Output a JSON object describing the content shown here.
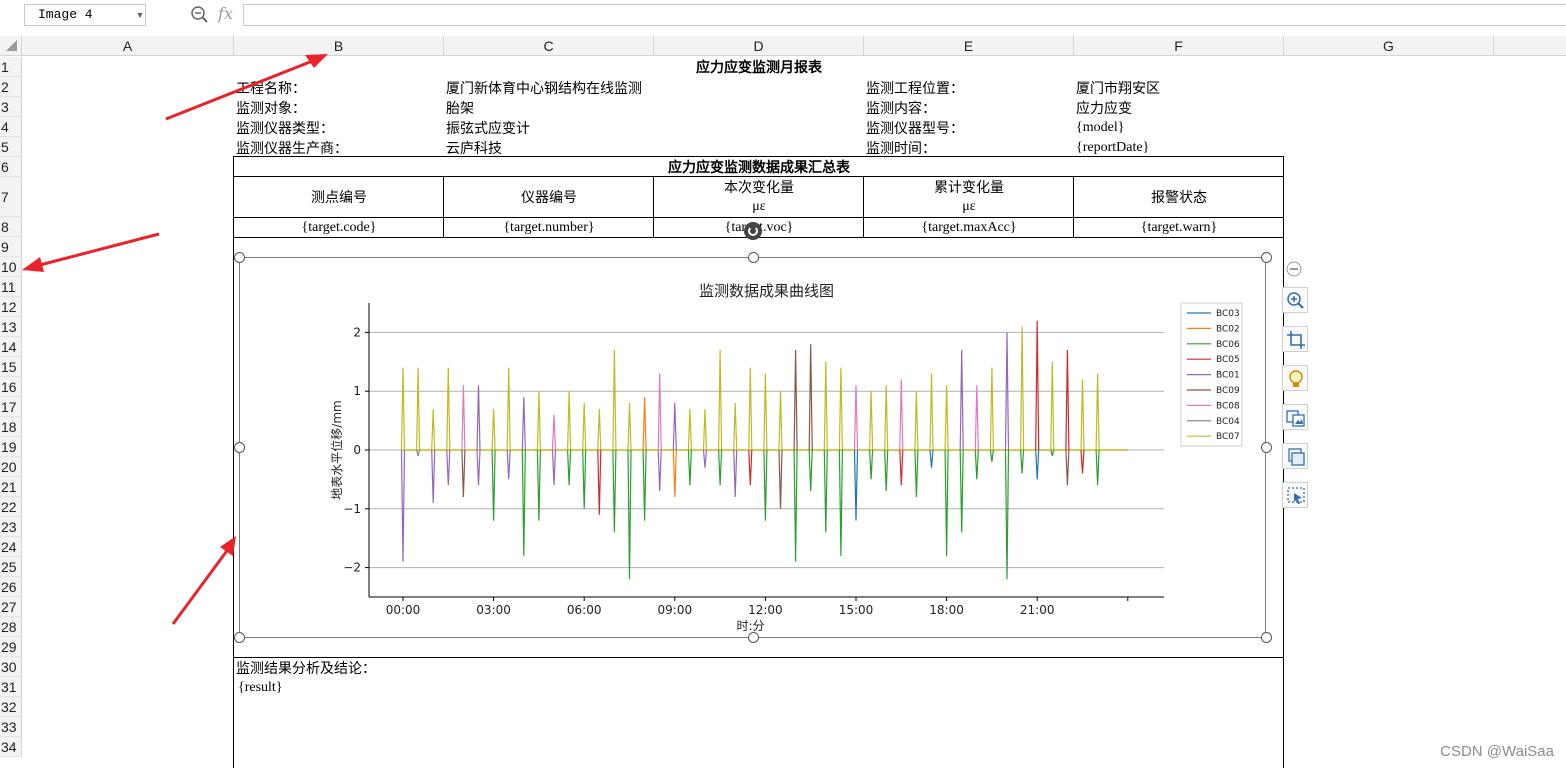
{
  "namebox": "Image 4",
  "formula_fx": "fx",
  "columns": [
    "A",
    "B",
    "C",
    "D",
    "E",
    "F",
    "G"
  ],
  "rows": [
    "1",
    "2",
    "3",
    "4",
    "5",
    "6",
    "7",
    "8",
    "9",
    "10",
    "11",
    "12",
    "13",
    "14",
    "15",
    "16",
    "17",
    "18",
    "19",
    "20",
    "21",
    "22",
    "23",
    "24",
    "25",
    "26",
    "27",
    "28",
    "29",
    "30",
    "31",
    "32",
    "33",
    "34"
  ],
  "report": {
    "title": "应力应变监测月报表",
    "project_name_label": "工程名称：",
    "project_name": "厦门新体育中心钢结构在线监测",
    "location_label": "监测工程位置：",
    "location": "厦门市翔安区",
    "object_label": "监测对象：",
    "object": "胎架",
    "content_label": "监测内容：",
    "content": "应力应变",
    "instrument_type_label": "监测仪器类型：",
    "instrument_type": "振弦式应变计",
    "model_label": "监测仪器型号：",
    "model": "{model}",
    "maker_label": "监测仪器生产商：",
    "maker": "云庐科技",
    "time_label": "监测时间：",
    "time": "{reportDate}"
  },
  "summary": {
    "title": "应力应变监测数据成果汇总表",
    "headers": [
      "测点编号",
      "仪器编号",
      "本次变化量",
      "累计变化量",
      "报警状态"
    ],
    "units": [
      "",
      "",
      "με",
      "με",
      ""
    ],
    "row": [
      "{target.code}",
      "{target.number}",
      "{target.voc}",
      "{target.maxAcc}",
      "{target.warn}"
    ]
  },
  "conclusion": {
    "label": "监测结果分析及结论：",
    "value": "{result}"
  },
  "watermark": "CSDN @WaiSaa",
  "colors": {
    "BC03": "#1f77b4",
    "BC02": "#ff7f0e",
    "BC06": "#2ca02c",
    "BC05": "#d62728",
    "BC01": "#9467bd",
    "BC09": "#8c564b",
    "BC08": "#e377c2",
    "BC04": "#7f7f7f",
    "BC07": "#bcbd22"
  },
  "toolbar_icons": [
    "minus-circle-icon",
    "zoom-in-icon",
    "crop-icon",
    "lightbulb-icon",
    "image-replace-icon",
    "image-copy-icon",
    "image-select-icon"
  ],
  "chart_data": {
    "type": "line",
    "title": "监测数据成果曲线图",
    "xlabel": "时:分",
    "ylabel": "地表水平位移/mm",
    "ylim": [
      -2.5,
      2.5
    ],
    "yticks": [
      "2",
      "1",
      "0",
      "−1",
      "−2"
    ],
    "xticks": [
      "00:00",
      "03:00",
      "06:00",
      "09:00",
      "12:00",
      "15:00",
      "18:00",
      "21:00"
    ],
    "grid": "horizontal",
    "legend_position": "right",
    "legend": [
      "BC03",
      "BC02",
      "BC06",
      "BC05",
      "BC01",
      "BC09",
      "BC08",
      "BC04",
      "BC07"
    ],
    "spikes": [
      {
        "t": 0.0,
        "v": 1.4,
        "s": "BC07"
      },
      {
        "t": 0.0,
        "v": -1.9,
        "s": "BC01"
      },
      {
        "t": 0.5,
        "v": 1.4,
        "s": "BC07"
      },
      {
        "t": 0.5,
        "v": -0.1,
        "s": "BC04"
      },
      {
        "t": 1.0,
        "v": 0.7,
        "s": "BC07"
      },
      {
        "t": 1.0,
        "v": -0.9,
        "s": "BC01"
      },
      {
        "t": 1.5,
        "v": 1.4,
        "s": "BC07"
      },
      {
        "t": 1.5,
        "v": -0.6,
        "s": "BC01"
      },
      {
        "t": 2.0,
        "v": 1.1,
        "s": "BC08"
      },
      {
        "t": 2.0,
        "v": -0.8,
        "s": "BC09"
      },
      {
        "t": 2.5,
        "v": 1.1,
        "s": "BC01"
      },
      {
        "t": 2.5,
        "v": -0.6,
        "s": "BC01"
      },
      {
        "t": 3.0,
        "v": 0.7,
        "s": "BC07"
      },
      {
        "t": 3.0,
        "v": -1.2,
        "s": "BC06"
      },
      {
        "t": 3.5,
        "v": 1.4,
        "s": "BC07"
      },
      {
        "t": 3.5,
        "v": -0.5,
        "s": "BC01"
      },
      {
        "t": 4.0,
        "v": 0.9,
        "s": "BC01"
      },
      {
        "t": 4.0,
        "v": -1.8,
        "s": "BC06"
      },
      {
        "t": 4.5,
        "v": 1.0,
        "s": "BC07"
      },
      {
        "t": 4.5,
        "v": -1.2,
        "s": "BC06"
      },
      {
        "t": 5.0,
        "v": 0.6,
        "s": "BC08"
      },
      {
        "t": 5.0,
        "v": -0.6,
        "s": "BC01"
      },
      {
        "t": 5.5,
        "v": 1.0,
        "s": "BC07"
      },
      {
        "t": 5.5,
        "v": -0.6,
        "s": "BC06"
      },
      {
        "t": 6.0,
        "v": 0.8,
        "s": "BC07"
      },
      {
        "t": 6.0,
        "v": -1.0,
        "s": "BC06"
      },
      {
        "t": 6.5,
        "v": 0.7,
        "s": "BC07"
      },
      {
        "t": 6.5,
        "v": -1.1,
        "s": "BC05"
      },
      {
        "t": 7.0,
        "v": 1.7,
        "s": "BC07"
      },
      {
        "t": 7.0,
        "v": -1.4,
        "s": "BC06"
      },
      {
        "t": 7.5,
        "v": 0.8,
        "s": "BC07"
      },
      {
        "t": 7.5,
        "v": -2.2,
        "s": "BC06"
      },
      {
        "t": 8.0,
        "v": 0.9,
        "s": "BC02"
      },
      {
        "t": 8.0,
        "v": -1.2,
        "s": "BC06"
      },
      {
        "t": 8.5,
        "v": 1.3,
        "s": "BC08"
      },
      {
        "t": 8.5,
        "v": -0.7,
        "s": "BC01"
      },
      {
        "t": 9.0,
        "v": 0.8,
        "s": "BC01"
      },
      {
        "t": 9.0,
        "v": -0.8,
        "s": "BC02"
      },
      {
        "t": 9.5,
        "v": 0.7,
        "s": "BC07"
      },
      {
        "t": 9.5,
        "v": -0.6,
        "s": "BC06"
      },
      {
        "t": 10.0,
        "v": 0.7,
        "s": "BC07"
      },
      {
        "t": 10.0,
        "v": -0.3,
        "s": "BC01"
      },
      {
        "t": 10.5,
        "v": 1.7,
        "s": "BC07"
      },
      {
        "t": 10.5,
        "v": -0.6,
        "s": "BC06"
      },
      {
        "t": 11.0,
        "v": 0.8,
        "s": "BC07"
      },
      {
        "t": 11.0,
        "v": -0.8,
        "s": "BC01"
      },
      {
        "t": 11.5,
        "v": 1.4,
        "s": "BC07"
      },
      {
        "t": 11.5,
        "v": -0.6,
        "s": "BC05"
      },
      {
        "t": 12.0,
        "v": 1.3,
        "s": "BC07"
      },
      {
        "t": 12.0,
        "v": -1.2,
        "s": "BC06"
      },
      {
        "t": 12.5,
        "v": 1.0,
        "s": "BC07"
      },
      {
        "t": 12.5,
        "v": -1.0,
        "s": "BC09"
      },
      {
        "t": 13.0,
        "v": 1.7,
        "s": "BC09"
      },
      {
        "t": 13.0,
        "v": -1.9,
        "s": "BC06"
      },
      {
        "t": 13.5,
        "v": 1.8,
        "s": "BC09"
      },
      {
        "t": 13.5,
        "v": -0.7,
        "s": "BC06"
      },
      {
        "t": 14.0,
        "v": 1.5,
        "s": "BC07"
      },
      {
        "t": 14.0,
        "v": -1.4,
        "s": "BC06"
      },
      {
        "t": 14.5,
        "v": 1.4,
        "s": "BC07"
      },
      {
        "t": 14.5,
        "v": -1.8,
        "s": "BC06"
      },
      {
        "t": 15.0,
        "v": 1.1,
        "s": "BC08"
      },
      {
        "t": 15.0,
        "v": -1.2,
        "s": "BC03"
      },
      {
        "t": 15.5,
        "v": 1.0,
        "s": "BC07"
      },
      {
        "t": 15.5,
        "v": -0.5,
        "s": "BC06"
      },
      {
        "t": 16.0,
        "v": 1.1,
        "s": "BC07"
      },
      {
        "t": 16.0,
        "v": -0.7,
        "s": "BC06"
      },
      {
        "t": 16.5,
        "v": 1.2,
        "s": "BC08"
      },
      {
        "t": 16.5,
        "v": -0.6,
        "s": "BC05"
      },
      {
        "t": 17.0,
        "v": 1.0,
        "s": "BC07"
      },
      {
        "t": 17.0,
        "v": -0.8,
        "s": "BC06"
      },
      {
        "t": 17.5,
        "v": 1.3,
        "s": "BC07"
      },
      {
        "t": 17.5,
        "v": -0.3,
        "s": "BC03"
      },
      {
        "t": 18.0,
        "v": 1.1,
        "s": "BC07"
      },
      {
        "t": 18.0,
        "v": -1.8,
        "s": "BC06"
      },
      {
        "t": 18.5,
        "v": 1.7,
        "s": "BC01"
      },
      {
        "t": 18.5,
        "v": -1.4,
        "s": "BC06"
      },
      {
        "t": 19.0,
        "v": 1.1,
        "s": "BC08"
      },
      {
        "t": 19.0,
        "v": -0.5,
        "s": "BC06"
      },
      {
        "t": 19.5,
        "v": 1.4,
        "s": "BC07"
      },
      {
        "t": 19.5,
        "v": -0.2,
        "s": "BC06"
      },
      {
        "t": 20.0,
        "v": 2.0,
        "s": "BC01"
      },
      {
        "t": 20.0,
        "v": -2.2,
        "s": "BC06"
      },
      {
        "t": 20.5,
        "v": 2.1,
        "s": "BC07"
      },
      {
        "t": 20.5,
        "v": -0.4,
        "s": "BC06"
      },
      {
        "t": 21.0,
        "v": 2.2,
        "s": "BC05"
      },
      {
        "t": 21.0,
        "v": -0.5,
        "s": "BC03"
      },
      {
        "t": 21.5,
        "v": 1.5,
        "s": "BC07"
      },
      {
        "t": 21.5,
        "v": -0.1,
        "s": "BC06"
      },
      {
        "t": 22.0,
        "v": 1.7,
        "s": "BC05"
      },
      {
        "t": 22.0,
        "v": -0.6,
        "s": "BC09"
      },
      {
        "t": 22.5,
        "v": 1.2,
        "s": "BC07"
      },
      {
        "t": 22.5,
        "v": -0.4,
        "s": "BC05"
      },
      {
        "t": 23.0,
        "v": 1.3,
        "s": "BC07"
      },
      {
        "t": 23.0,
        "v": -0.6,
        "s": "BC06"
      }
    ]
  }
}
